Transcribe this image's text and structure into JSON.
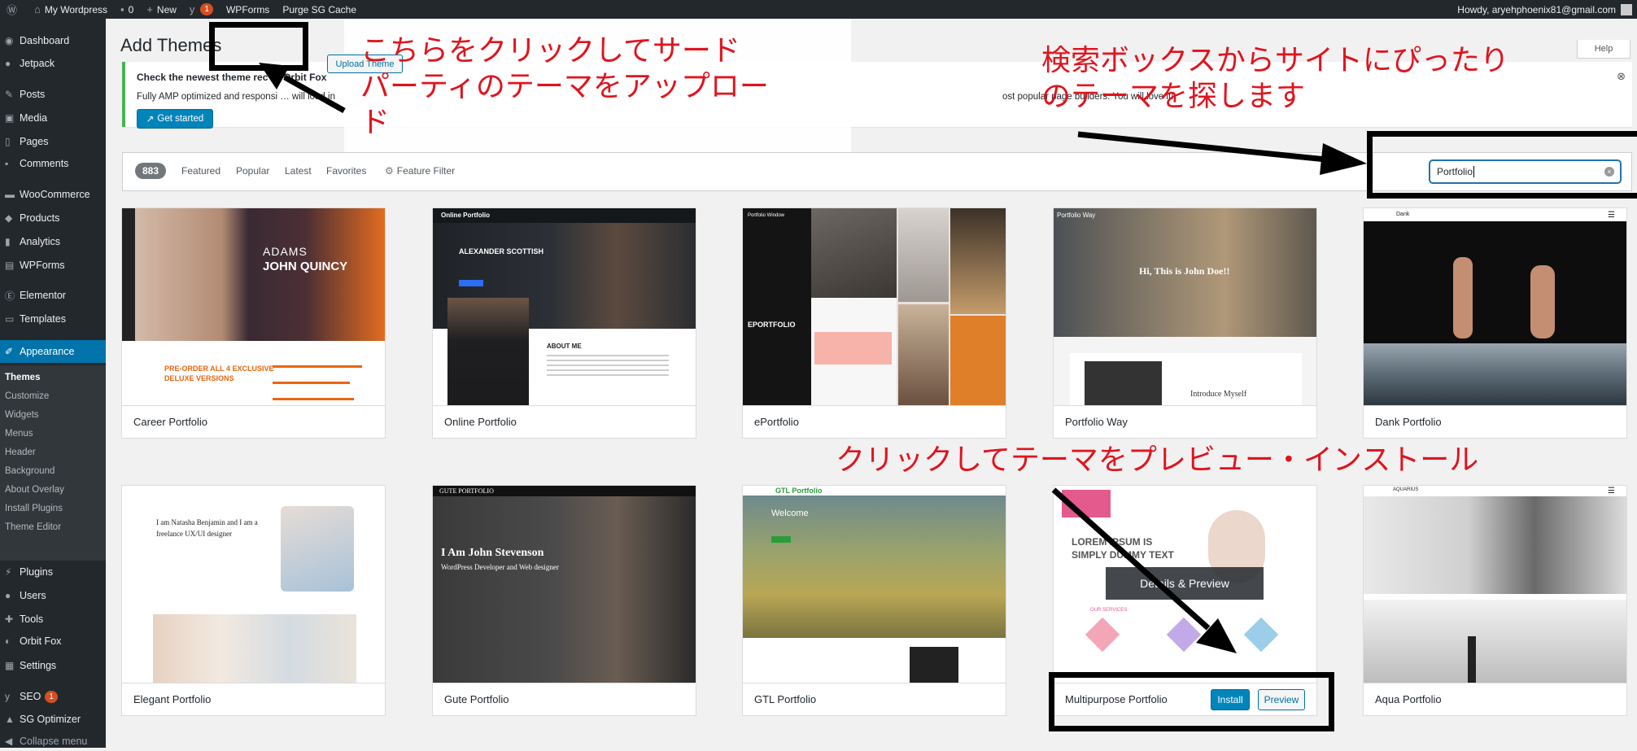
{
  "admin_bar": {
    "site_name": "My Wordpress",
    "comments_count": "0",
    "new_label": "New",
    "updates_badge": "1",
    "wpforms": "WPForms",
    "purge": "Purge SG Cache",
    "howdy": "Howdy, aryehphoenix81@gmail.com"
  },
  "sidebar": {
    "items": [
      {
        "label": "Dashboard",
        "icon": "dashboard-icon"
      },
      {
        "label": "Jetpack",
        "icon": "jetpack-icon"
      },
      {
        "label": "Posts",
        "icon": "pin-icon"
      },
      {
        "label": "Media",
        "icon": "media-icon"
      },
      {
        "label": "Pages",
        "icon": "page-icon"
      },
      {
        "label": "Comments",
        "icon": "comment-icon"
      },
      {
        "label": "WooCommerce",
        "icon": "woo-icon"
      },
      {
        "label": "Products",
        "icon": "box-icon"
      },
      {
        "label": "Analytics",
        "icon": "chart-icon"
      },
      {
        "label": "WPForms",
        "icon": "form-icon"
      },
      {
        "label": "Elementor",
        "icon": "elementor-icon"
      },
      {
        "label": "Templates",
        "icon": "folder-icon"
      },
      {
        "label": "Appearance",
        "icon": "brush-icon"
      },
      {
        "label": "Plugins",
        "icon": "plug-icon"
      },
      {
        "label": "Users",
        "icon": "user-icon"
      },
      {
        "label": "Tools",
        "icon": "wrench-icon"
      },
      {
        "label": "Orbit Fox",
        "icon": "fox-icon"
      },
      {
        "label": "Settings",
        "icon": "settings-icon"
      },
      {
        "label": "SEO",
        "icon": "seo-icon",
        "badge": "1"
      },
      {
        "label": "SG Optimizer",
        "icon": "sg-icon"
      },
      {
        "label": "Collapse menu",
        "icon": "collapse-icon"
      }
    ],
    "submenu": [
      "Themes",
      "Customize",
      "Widgets",
      "Menus",
      "Header",
      "Background",
      "About Overlay",
      "Install Plugins",
      "Theme Editor"
    ]
  },
  "header": {
    "title": "Add Themes",
    "upload_label": "Upload Theme",
    "help_label": "Help"
  },
  "notice": {
    "line1": "Check the newest theme rec",
    "line1_tail": "Orbit Fox",
    "line2": "Fully AMP optimized and responsi",
    "line2_mid": "will load in",
    "line2_tail": "ost popular page builders. You will love it!",
    "button": "Get started"
  },
  "filter": {
    "count": "883",
    "tabs": [
      "Featured",
      "Popular",
      "Latest",
      "Favorites"
    ],
    "feature_filter": "Feature Filter",
    "search_value": "Portfolio"
  },
  "themes": [
    {
      "name": "Career Portfolio",
      "shot": {
        "l1": "ADAMS",
        "l2": "JOHN QUINCY",
        "l3": "PRE-ORDER ALL 4 EXCLUSIVE",
        "l4": "DELUXE VERSIONS"
      }
    },
    {
      "name": "Online Portfolio",
      "shot": {
        "nav": "Online Portfolio",
        "l1": "ALEXANDER SCOTTISH",
        "l2": "ABOUT ME"
      }
    },
    {
      "name": "ePortfolio",
      "shot": {
        "nav": "Portfolio Window",
        "l1": "EPORTFOLIO"
      }
    },
    {
      "name": "Portfolio Way",
      "shot": {
        "nav": "Portfolio Way",
        "l1": "Hi, This is John Doe!!",
        "l2": "Introduce Myself"
      }
    },
    {
      "name": "Dank Portfolio",
      "shot": {
        "nav": "Dank"
      }
    },
    {
      "name": "Elegant Portfolio",
      "shot": {
        "l1": "I am Natasha Benjamin and I am a",
        "l2": "freelance UX/UI designer"
      }
    },
    {
      "name": "Gute Portfolio",
      "shot": {
        "nav": "GUTE PORTFOLIO",
        "l1": "I Am John Stevenson",
        "l2": "WordPress Developer and Web designer"
      }
    },
    {
      "name": "GTL Portfolio",
      "shot": {
        "nav": "GTL Portfolio",
        "l1": "Welcome"
      }
    },
    {
      "name": "Multipurpose Portfolio",
      "install": "Install",
      "preview": "Preview",
      "overlay": "Details & Preview",
      "shot": {
        "l1": "LOREM IPSUM IS",
        "l2": "SIMPLY DUMMY TEXT",
        "l3": "OUR SERVICES"
      }
    },
    {
      "name": "Aqua Portfolio",
      "shot": {
        "nav": "AQUARIUS"
      }
    }
  ],
  "annotations": {
    "upload": [
      "こちらをクリックしてサード",
      "パーティのテーマをアップロー",
      "ド"
    ],
    "search": [
      "検索ボックスからサイトにぴったり",
      "のテーマを探します"
    ],
    "preview": "クリックしてテーマをプレビュー・インストール"
  },
  "colors": {
    "accent": "#0073aa",
    "annotation": "#e0141e",
    "adminbar": "#23282d"
  }
}
